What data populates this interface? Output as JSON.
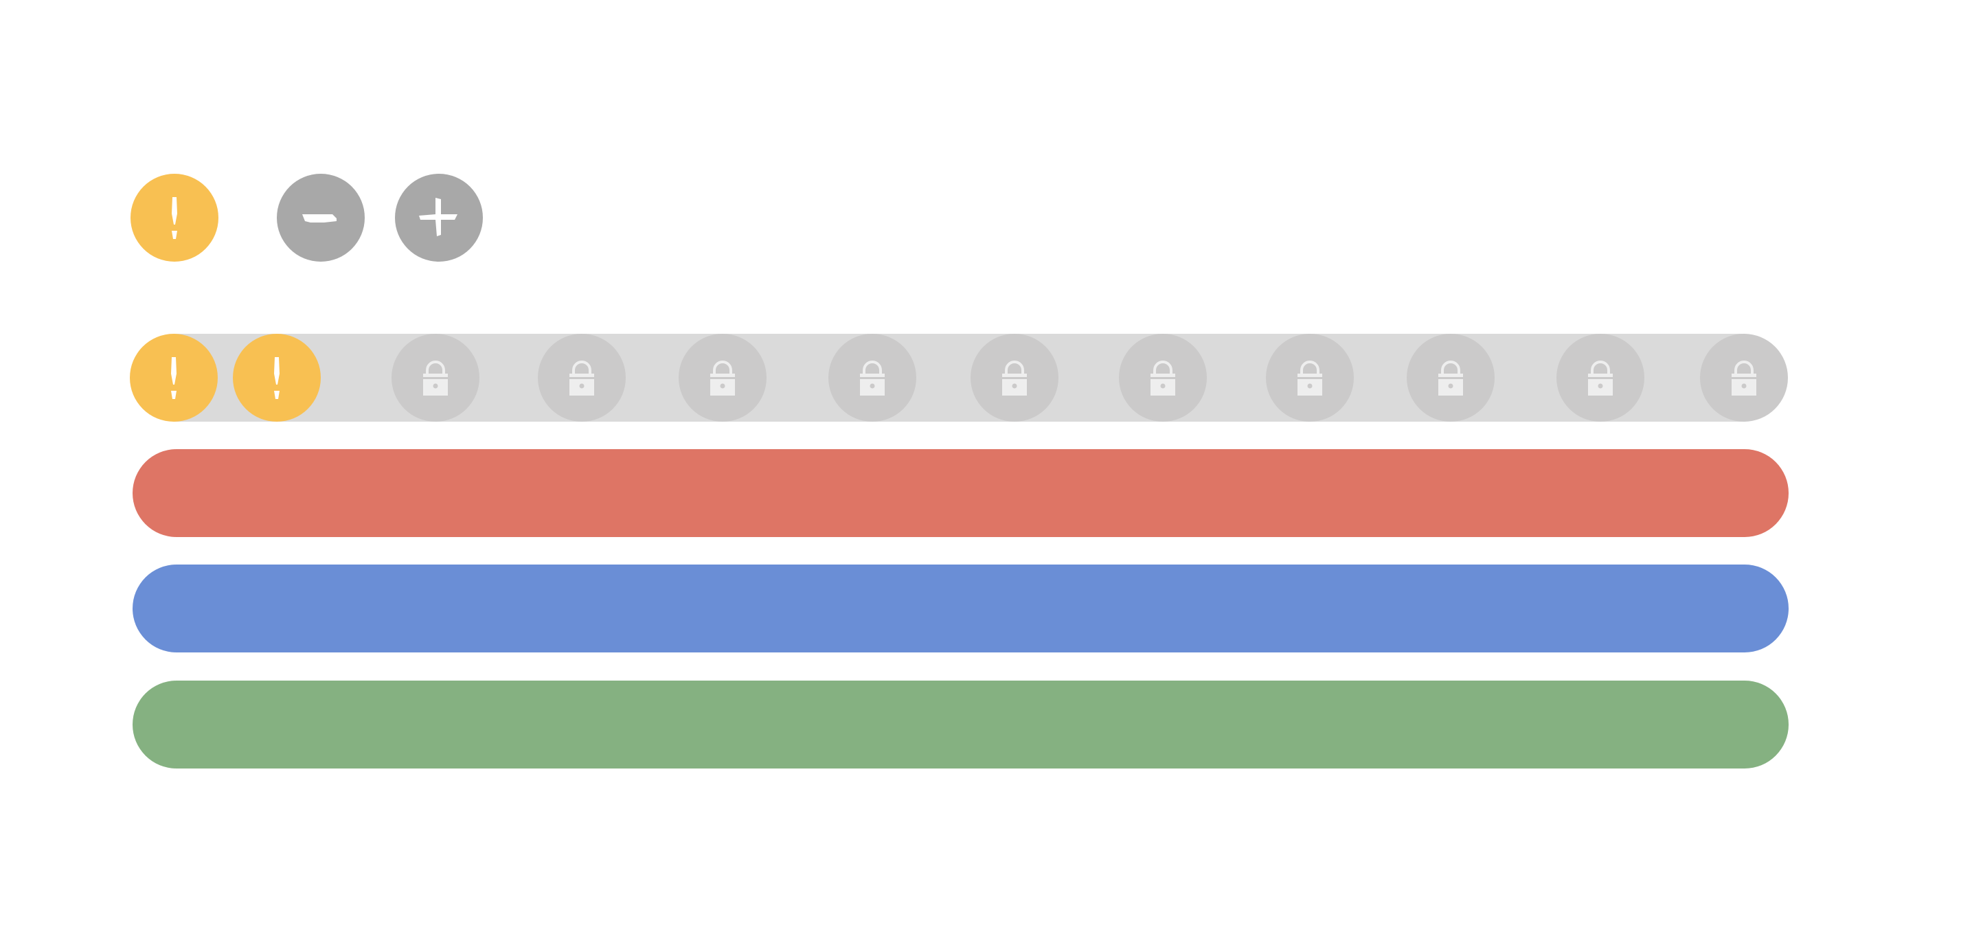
{
  "colors": {
    "alert": "#f8c052",
    "control": "#a8a8a8",
    "locked": "#cbcaca",
    "track": "#dadada",
    "bar_red": "#de7565",
    "bar_blue": "#6a8ed6",
    "bar_green": "#85b181"
  },
  "controls": {
    "alert": {
      "icon": "exclamation-icon"
    },
    "minus": {
      "icon": "minus-icon"
    },
    "plus": {
      "icon": "plus-icon"
    }
  },
  "level_track": {
    "total": 12,
    "unlocked": 2,
    "unlocked_icon": "exclamation-icon",
    "locked_icon": "padlock-icon"
  },
  "bars": [
    {
      "name": "red-bar",
      "color": "#de7565"
    },
    {
      "name": "blue-bar",
      "color": "#6a8ed6"
    },
    {
      "name": "green-bar",
      "color": "#85b181"
    }
  ]
}
